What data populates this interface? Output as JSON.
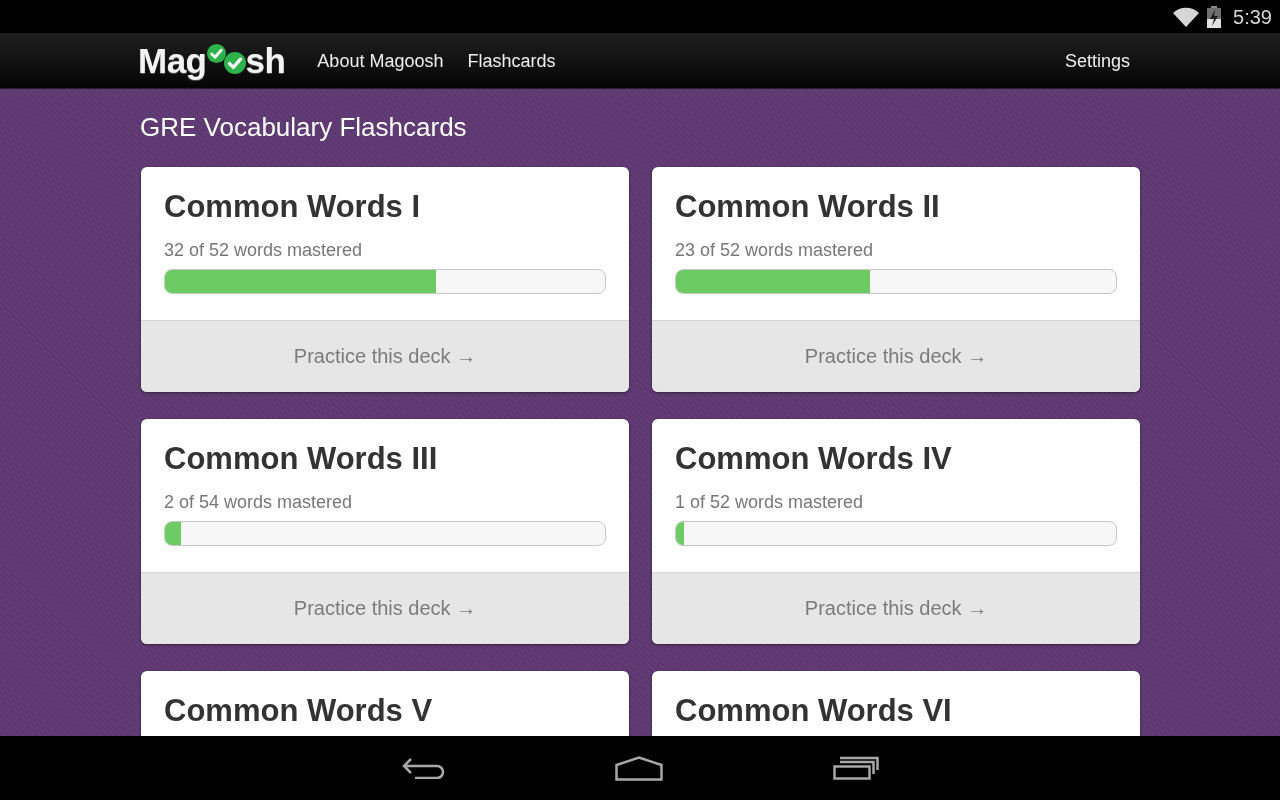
{
  "status_bar": {
    "time": "5:39"
  },
  "nav": {
    "logo": {
      "before": "Mag",
      "after": "sh"
    },
    "links": [
      "About Magoosh",
      "Flashcards"
    ],
    "settings": "Settings"
  },
  "page": {
    "title": "GRE Vocabulary Flashcards"
  },
  "cards": [
    {
      "title": "Common Words I",
      "progress": "32 of 52 words mastered",
      "level": 0.615,
      "action": "Practice this deck →"
    },
    {
      "title": "Common Words II",
      "progress": "23 of 52 words mastered",
      "level": 0.442,
      "action": "Practice this deck →"
    },
    {
      "title": "Common Words III",
      "progress": "2 of 54 words mastered",
      "level": 0.037,
      "action": "Practice this deck →"
    },
    {
      "title": "Common Words IV",
      "progress": "1 of 52 words mastered",
      "level": 0.019,
      "action": "Practice this deck →"
    },
    {
      "title": "Common Words V"
    },
    {
      "title": "Common Words VI"
    }
  ]
}
